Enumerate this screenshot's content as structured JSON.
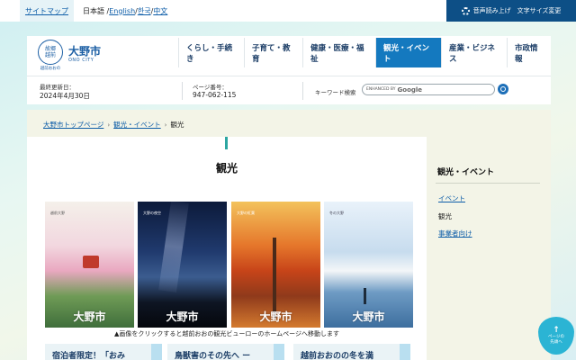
{
  "topbar": {
    "sitemap": "サイトマップ",
    "lang_ja": "日本語 /",
    "lang_en": "English",
    "lang_sep1": " /",
    "lang_ko": "한국",
    "lang_sep2": " /",
    "lang_zh": "中文",
    "voice_button": "音声読み上げ　文字サイズ変更"
  },
  "logo": {
    "emblem_text": "故郷\n越前",
    "emblem_sub": "越前おおの",
    "city_name": "大野市",
    "city_en": "ONO CITY"
  },
  "nav": [
    {
      "label": "くらし・手続き",
      "active": false
    },
    {
      "label": "子育て・教育",
      "active": false
    },
    {
      "label": "健康・医療・福祉",
      "active": false
    },
    {
      "label": "観光・イベント",
      "active": true
    },
    {
      "label": "産業・ビジネス",
      "active": false
    },
    {
      "label": "市政情報",
      "active": false
    }
  ],
  "info": {
    "updated_label": "最終更新日：",
    "updated_value": "2024年4月30日",
    "page_no_label": "ページ番号：",
    "page_no_value": "947-062-115",
    "keyword_label": "キーワード検索",
    "search_enhanced": "ENHANCED BY",
    "search_google": "Google"
  },
  "breadcrumb": {
    "home": "大野市トップページ",
    "parent": "観光・イベント",
    "current": "観光"
  },
  "main": {
    "title": "観光",
    "posters": [
      {
        "title": "大野市",
        "subtitle": "越前大野",
        "palette": "spring"
      },
      {
        "title": "大野市",
        "subtitle": "大野の夜空",
        "palette": "night"
      },
      {
        "title": "大野市",
        "subtitle": "大野の紅葉",
        "palette": "autumn"
      },
      {
        "title": "大野市",
        "subtitle": "冬の大野",
        "palette": "winter"
      }
    ],
    "caption": "▲画像をクリックすると越前おおの観光ビューローのホームページへ移動します",
    "cards": [
      "宿泊者限定！「おみ",
      "鳥獣害のその先へ ー",
      "越前おおのの冬を満"
    ]
  },
  "sidebar": {
    "title": "観光・イベント",
    "items": [
      {
        "label": "イベント",
        "link": true
      },
      {
        "label": "観光",
        "link": false
      },
      {
        "label": "事業者向け",
        "link": true
      }
    ]
  },
  "pagetop": {
    "line1": "ページの",
    "line2": "先頭へ"
  }
}
